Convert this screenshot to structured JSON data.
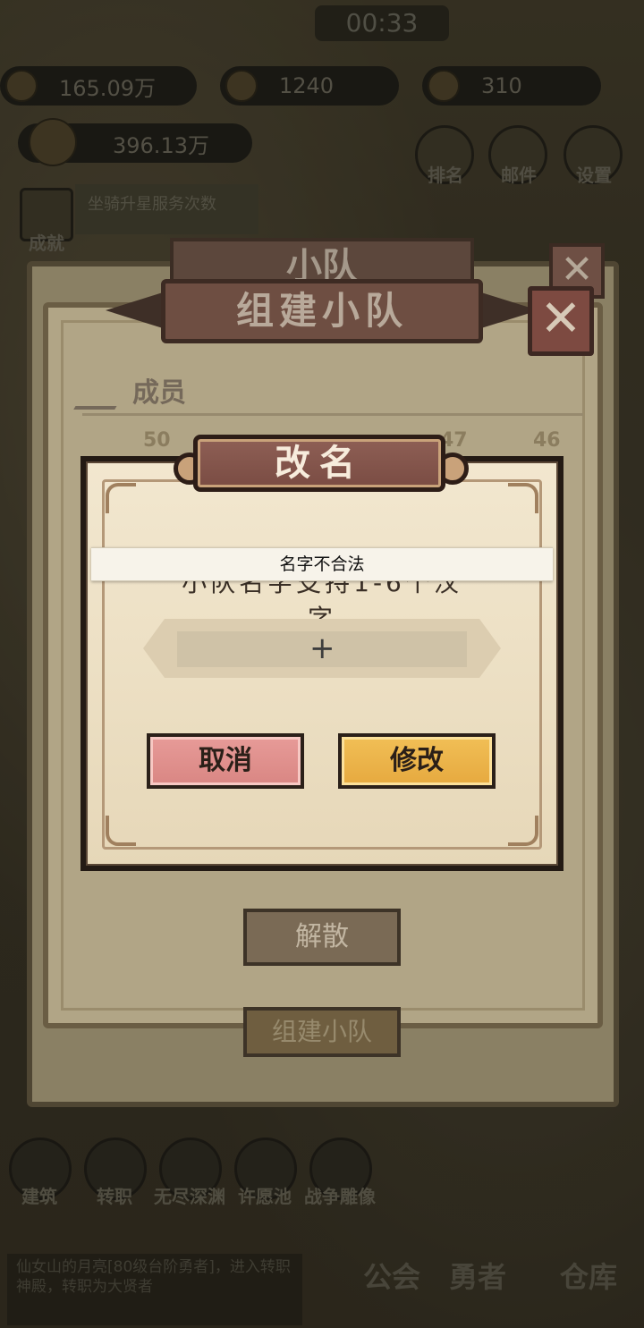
{
  "hud": {
    "timer": "00:33",
    "gold": "165.09万",
    "gems": "1240",
    "tickets": "310",
    "power": "396.13万",
    "quest_text": "坐骑升星服务次数",
    "top_buttons": [
      "排名",
      "邮件",
      "设置"
    ],
    "achievement_label": "成就"
  },
  "bottom_nav": {
    "icons": [
      "建筑",
      "转职",
      "无尽深渊",
      "许愿池",
      "战争雕像"
    ],
    "tabs": [
      "公会",
      "勇者",
      "仓库"
    ],
    "chat": "仙女山的月亮[80级台阶勇者]，进入转职神殿，转职为大贤者"
  },
  "back_panel": {
    "title": "小队",
    "close": "✕"
  },
  "team_panel": {
    "title": "组建小队",
    "close": "✕",
    "members_label": "成员",
    "slots": [
      "50",
      "47",
      "46"
    ],
    "dissolve_label": "解散",
    "create_label": "组建小队"
  },
  "rename_dialog": {
    "title": "改名",
    "hint": "小队名字支持1-6个汉字",
    "input_value": "",
    "cursor_glyph": "+",
    "cancel_label": "取消",
    "confirm_label": "修改"
  },
  "toast": {
    "message": "名字不合法"
  }
}
